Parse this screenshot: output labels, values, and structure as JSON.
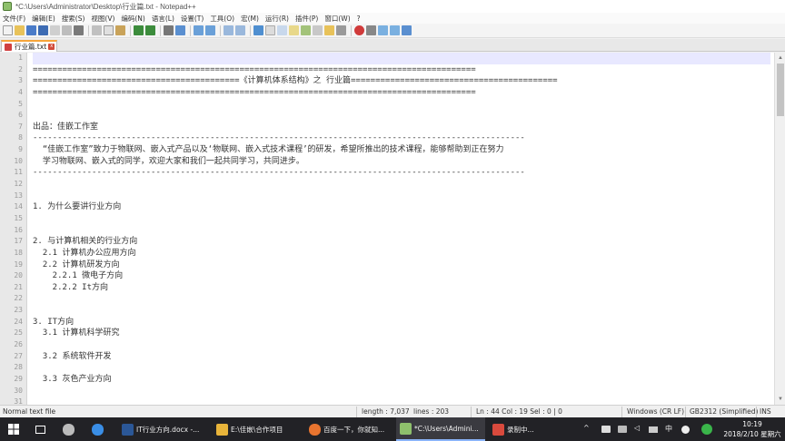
{
  "window": {
    "title": "*C:\\Users\\Administrator\\Desktop\\行业篇.txt - Notepad++"
  },
  "menu": [
    "文件(F)",
    "编辑(E)",
    "搜索(S)",
    "视图(V)",
    "编码(N)",
    "语言(L)",
    "设置(T)",
    "工具(O)",
    "宏(M)",
    "运行(R)",
    "插件(P)",
    "窗口(W)",
    "?"
  ],
  "tab": {
    "label": "行业篇.txt",
    "close": "x"
  },
  "editor": {
    "lines": [
      "",
      "==========================================================================================",
      "==========================================《计算机体系结构》之 行业篇==========================================",
      "==========================================================================================",
      "",
      "",
      "出品：佳嵌工作室",
      "----------------------------------------------------------------------------------------------------",
      "  “佳嵌工作室”致力于物联网、嵌入式产品以及‘物联网、嵌入式技术课程’的研发，希望所推出的技术课程，能够帮助到正在努力",
      "  学习物联网、嵌入式的同学，欢迎大家和我们一起共同学习，共同进步。",
      "----------------------------------------------------------------------------------------------------",
      "",
      "",
      "1. 为什么要讲行业方向",
      "",
      "",
      "2. 与计算机相关的行业方向",
      "  2.1 计算机办公应用方向",
      "  2.2 计算机研发方向",
      "    2.2.1 微电子方向",
      "    2.2.2 It方向",
      "",
      "",
      "3. IT方向",
      "  3.1 计算机科学研究",
      "",
      "  3.2 系统软件开发",
      "",
      "  3.3 灰色产业方向",
      "",
      ""
    ]
  },
  "status": {
    "file_type": "Normal text file",
    "length": "length : 7,037",
    "lines": "lines : 203",
    "position": "Ln : 44   Col : 19   Sel : 0 | 0",
    "eol": "Windows (CR LF)",
    "encoding": "GB2312 (Simplified)",
    "mode": "INS"
  },
  "taskbar": {
    "items": [
      {
        "label": "IT行业方向.docx -...",
        "color": "#2b5797"
      },
      {
        "label": "E:\\佳嵌\\合作项目",
        "color": "#e8b43a"
      },
      {
        "label": "百度一下，你就知...",
        "color": "#e8742f"
      },
      {
        "label": "*C:\\Users\\Admini...",
        "color": "#8ec06c"
      },
      {
        "label": "录制中...",
        "color": "#d94a3d"
      }
    ],
    "ime": "中",
    "time": "10:19",
    "date": "2018/2/10 星期六"
  },
  "colors": {
    "accent_tab": "#f6a53a",
    "taskbar_bg": "#222226",
    "gutter_bg": "#e8e8e8"
  }
}
